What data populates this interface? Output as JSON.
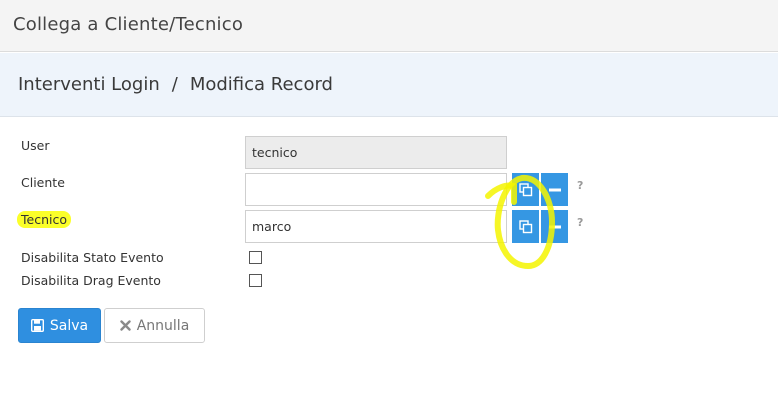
{
  "window": {
    "title": "Collega a Cliente/Tecnico"
  },
  "breadcrumb": {
    "parent": "Interventi Login",
    "separator": "/",
    "current": "Modifica Record"
  },
  "form": {
    "user": {
      "label": "User",
      "value": "tecnico"
    },
    "cliente": {
      "label": "Cliente",
      "value": ""
    },
    "tecnico": {
      "label": "Tecnico",
      "value": "marco"
    },
    "disabilita_stato": {
      "label": "Disabilita Stato Evento",
      "checked": false
    },
    "disabilita_drag": {
      "label": "Disabilita Drag Evento",
      "checked": false
    },
    "help_glyph": "?"
  },
  "buttons": {
    "save_label": "Salva",
    "cancel_label": "Annulla"
  },
  "colors": {
    "accent": "#3597e3",
    "highlight": "#fbff2a"
  },
  "icons": {
    "lookup": "copy-icon",
    "clear": "minus-icon",
    "save": "floppy-disk-icon",
    "cancel": "close-icon"
  }
}
